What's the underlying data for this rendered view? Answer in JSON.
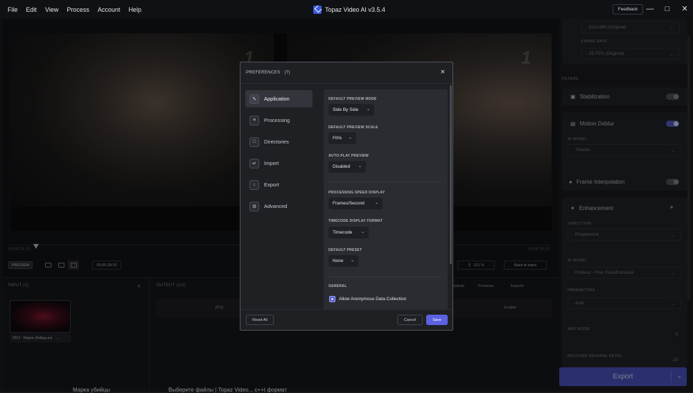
{
  "app": {
    "title": "Topaz Video AI  v3.5.4",
    "menu": [
      "File",
      "Edit",
      "View",
      "Process",
      "Account",
      "Help"
    ],
    "feedback_label": "Feedback"
  },
  "viewer": {
    "watermark": "1",
    "timecode_start": "00:05:28:20",
    "timecode_end": "00:05:30:20",
    "preview_label": "PREVIEW",
    "current_timecode": "00:05:28:20",
    "zoom_value": "115 %",
    "back_to_input": "Back to input"
  },
  "input_panel": {
    "title": "INPUT (1)",
    "add_icon": "+",
    "thumbnail_caption": "0013 - Марка убийцы.avi",
    "more_icon": "..."
  },
  "output_panel": {
    "title": "OUTPUT (1/1)",
    "tabs": [
      "Outputs",
      "Previews",
      "Exports"
    ],
    "row_label": "[PG]",
    "row_status": "Enable"
  },
  "sidebar": {
    "resolution_value": "812x384 (Original)",
    "frame_rate_label": "FRAME RATE",
    "frame_rate_value": "25 FPS (Original)",
    "filters_label": "FILTERS",
    "stabilization_label": "Stabilization",
    "motion_deblur_label": "Motion Deblur",
    "ai_model_label": "AI MODEL",
    "motion_deblur_model": "Themis",
    "frame_interp_label": "Frame Interpolation",
    "enhancement_label": "Enhancement",
    "video_type_label": "VIDEO TYPE",
    "video_type_value": "Progressive",
    "enh_ai_model_label": "AI MODEL",
    "enh_ai_model_value": "Proteus - Fine Tune/Enhance",
    "parameters_label": "PARAMETERS",
    "parameters_value": "Auto",
    "add_noise_label": "ADD NOISE",
    "add_noise_value": "0",
    "recover_label": "RECOVER ORIGINAL DETAIL",
    "recover_value": "20",
    "export_label": "Export"
  },
  "taskbar": {
    "left_text": "Марка убийцы",
    "right_text": "Выберите файлы | Topaz Video... с++t формат"
  },
  "dialog": {
    "title": "PREFERENCES",
    "help_icon": "(?)",
    "close_icon": "×",
    "nav": [
      {
        "label": "Application",
        "icon": "application-icon"
      },
      {
        "label": "Processing",
        "icon": "processing-icon"
      },
      {
        "label": "Directories",
        "icon": "folder-icon"
      },
      {
        "label": "Import",
        "icon": "import-icon"
      },
      {
        "label": "Export",
        "icon": "export-icon"
      },
      {
        "label": "Advanced",
        "icon": "advanced-icon"
      }
    ],
    "settings": {
      "preview_mode_label": "DEFAULT PREVIEW MODE",
      "preview_mode_value": "Side By Side",
      "preview_scale_label": "DEFAULT PREVIEW SCALE",
      "preview_scale_value": "Fit%",
      "autoplay_label": "AUTO-PLAY PREVIEW",
      "autoplay_value": "Disabled",
      "speed_display_label": "PROCESSING SPEED DISPLAY",
      "speed_display_value": "Frames/Second",
      "timecode_label": "TIMECODE DISPLAY FORMAT",
      "timecode_value": "Timecode",
      "preset_label": "DEFAULT PRESET",
      "preset_value": "None",
      "general_label": "GENERAL",
      "anon_data_label": "Allow Anonymous Data Collection",
      "anon_data_checked": true
    },
    "reset_label": "Reset All",
    "cancel_label": "Cancel",
    "save_label": "Save"
  },
  "colors": {
    "accent": "#5b62e2",
    "background": "#1b1c20",
    "dialog_bg": "#1f2024"
  }
}
